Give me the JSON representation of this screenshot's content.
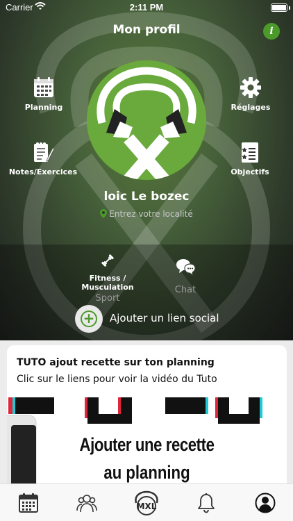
{
  "status_bar": {
    "carrier": "Carrier",
    "time": "2:11 PM",
    "battery_level": 1.0
  },
  "header": {
    "title": "Mon profil",
    "info_glyph": "i"
  },
  "menu": {
    "planning": "Planning",
    "settings": "Réglages",
    "notes": "Notes/Exercices",
    "goals": "Objectifs"
  },
  "profile": {
    "avatar_letter": "X",
    "name": "loic Le bozec",
    "location_placeholder": "Entrez votre localité"
  },
  "tabs": {
    "sport": {
      "value": "Fitness / Musculation",
      "label": "Sport"
    },
    "chat": {
      "label": "Chat"
    }
  },
  "social": {
    "add_glyph": "+",
    "add_label": "Ajouter un lien social"
  },
  "card": {
    "title": "TUTO ajout recette sur ton planning",
    "subtitle": "Clic sur le liens pour voir la vidéo du Tuto",
    "thumbnail_line1": "Ajouter une recette",
    "thumbnail_line2": "au planning"
  },
  "brand_logo_text": "MXL",
  "icons": {
    "info": "info-icon",
    "planning": "calendar-icon",
    "settings": "gear-icon",
    "notes": "notepad-pencil-icon",
    "goals": "checklist-icon",
    "sport": "dumbbell-icon",
    "chat": "chat-bubbles-icon",
    "location": "location-pin-icon",
    "add": "plus-circle-icon",
    "nav_calendar": "calendar-icon",
    "nav_community": "community-icon",
    "nav_brand": "brand-logo-icon",
    "nav_notifications": "bell-icon",
    "nav_profile": "profile-icon"
  },
  "colors": {
    "accent": "#4c9a2a",
    "hero_green": "#5a7a3a",
    "avatar_green": "#6aaa3c",
    "card_bg": "#ececec"
  }
}
